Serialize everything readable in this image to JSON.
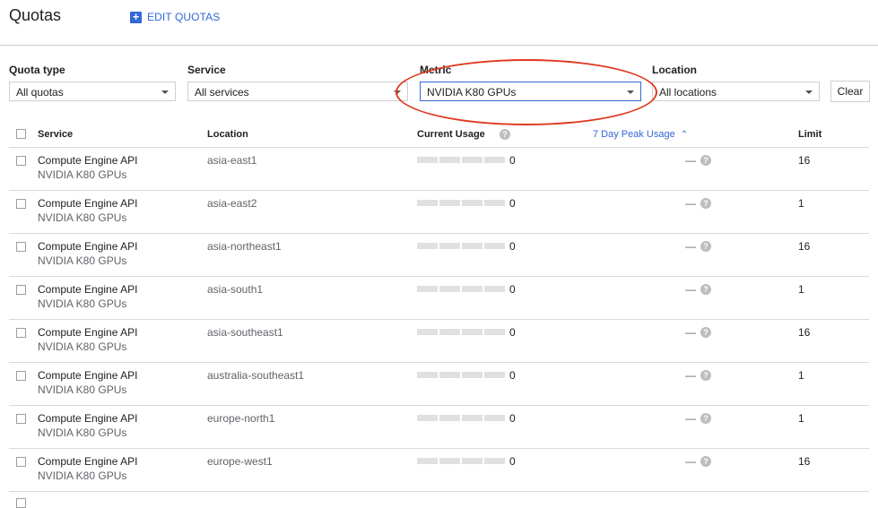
{
  "header": {
    "title": "Quotas",
    "edit_label": "EDIT QUOTAS"
  },
  "filters": {
    "quota_type": {
      "label": "Quota type",
      "value": "All quotas"
    },
    "service": {
      "label": "Service",
      "value": "All services"
    },
    "metric": {
      "label": "Metric",
      "value": "NVIDIA K80 GPUs"
    },
    "location": {
      "label": "Location",
      "value": "All locations"
    },
    "clear_label": "Clear"
  },
  "table": {
    "columns": {
      "service": "Service",
      "location": "Location",
      "current_usage": "Current Usage",
      "peak": "7 Day Peak Usage",
      "limit": "Limit"
    },
    "rows": [
      {
        "service": "Compute Engine API",
        "metric": "NVIDIA K80 GPUs",
        "location": "asia-east1",
        "usage": "0",
        "peak": "—",
        "limit": "16"
      },
      {
        "service": "Compute Engine API",
        "metric": "NVIDIA K80 GPUs",
        "location": "asia-east2",
        "usage": "0",
        "peak": "—",
        "limit": "1"
      },
      {
        "service": "Compute Engine API",
        "metric": "NVIDIA K80 GPUs",
        "location": "asia-northeast1",
        "usage": "0",
        "peak": "—",
        "limit": "16"
      },
      {
        "service": "Compute Engine API",
        "metric": "NVIDIA K80 GPUs",
        "location": "asia-south1",
        "usage": "0",
        "peak": "—",
        "limit": "1"
      },
      {
        "service": "Compute Engine API",
        "metric": "NVIDIA K80 GPUs",
        "location": "asia-southeast1",
        "usage": "0",
        "peak": "—",
        "limit": "16"
      },
      {
        "service": "Compute Engine API",
        "metric": "NVIDIA K80 GPUs",
        "location": "australia-southeast1",
        "usage": "0",
        "peak": "—",
        "limit": "1"
      },
      {
        "service": "Compute Engine API",
        "metric": "NVIDIA K80 GPUs",
        "location": "europe-north1",
        "usage": "0",
        "peak": "—",
        "limit": "1"
      },
      {
        "service": "Compute Engine API",
        "metric": "NVIDIA K80 GPUs",
        "location": "europe-west1",
        "usage": "0",
        "peak": "—",
        "limit": "16"
      }
    ]
  },
  "colors": {
    "accent": "#3367d6",
    "annotation": "#e0381e"
  }
}
